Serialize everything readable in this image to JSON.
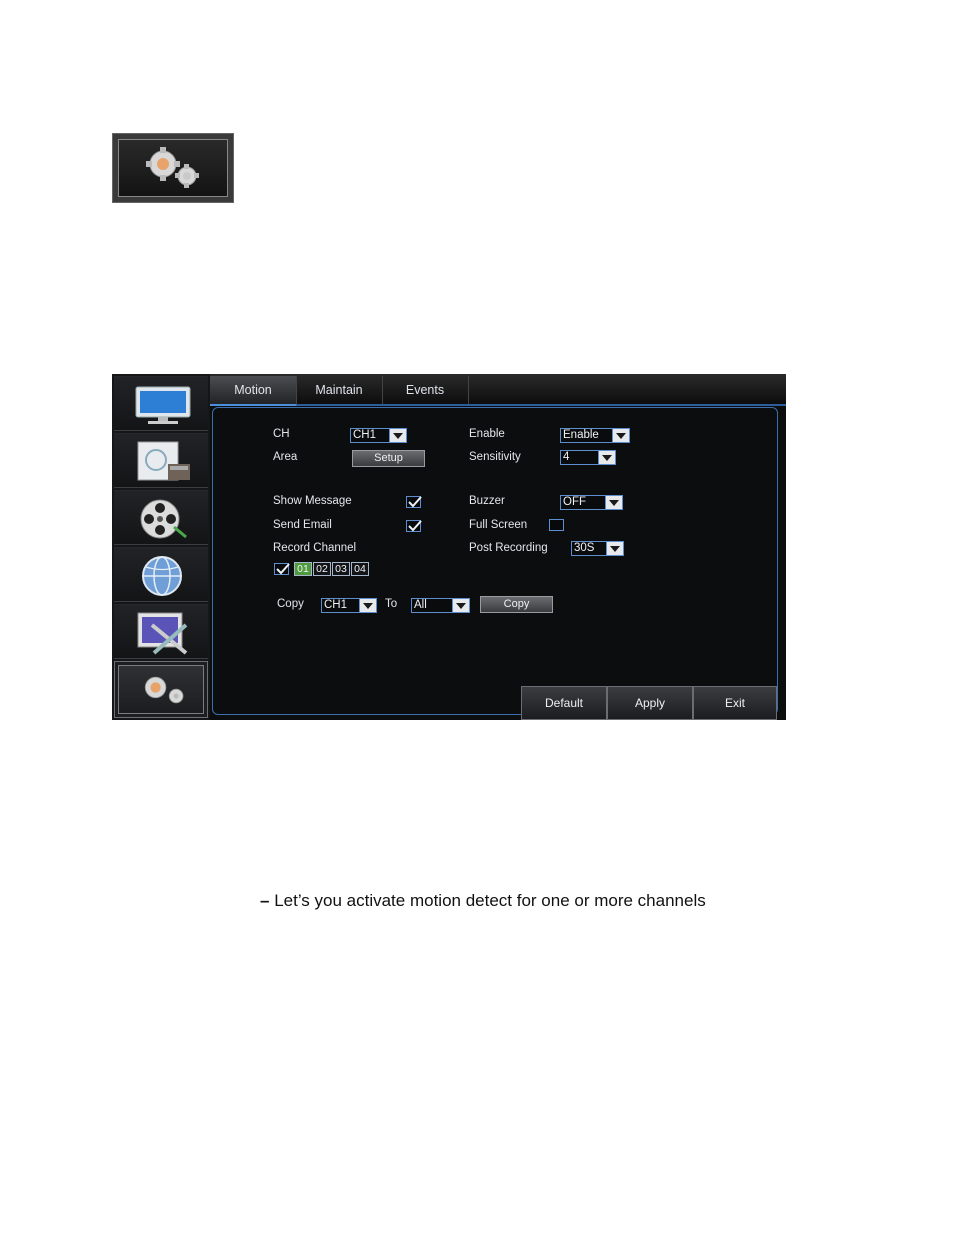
{
  "sidebar": {
    "items": [
      {
        "name": "display"
      },
      {
        "name": "record"
      },
      {
        "name": "search"
      },
      {
        "name": "network"
      },
      {
        "name": "system"
      },
      {
        "name": "advanced",
        "active": true
      }
    ]
  },
  "tabs": [
    {
      "label": "Motion",
      "active": true
    },
    {
      "label": "Maintain",
      "active": false
    },
    {
      "label": "Events",
      "active": false
    }
  ],
  "form": {
    "ch_label": "CH",
    "ch_value": "CH1",
    "enable_label": "Enable",
    "enable_value": "Enable",
    "area_label": "Area",
    "setup_button": "Setup",
    "sensitivity_label": "Sensitivity",
    "sensitivity_value": "4",
    "show_message_label": "Show Message",
    "show_message_checked": true,
    "buzzer_label": "Buzzer",
    "buzzer_value": "OFF",
    "send_email_label": "Send Email",
    "send_email_checked": true,
    "full_screen_label": "Full Screen",
    "full_screen_checked": false,
    "record_channel_label": "Record Channel",
    "record_all_checked": true,
    "post_recording_label": "Post Recording",
    "post_recording_value": "30S",
    "channels": [
      {
        "label": "01",
        "selected": true
      },
      {
        "label": "02",
        "selected": false
      },
      {
        "label": "03",
        "selected": false
      },
      {
        "label": "04",
        "selected": false
      }
    ],
    "copy_label": "Copy",
    "copy_from_value": "CH1",
    "to_label": "To",
    "copy_to_value": "All",
    "copy_button": "Copy"
  },
  "footer": {
    "default_button": "Default",
    "apply_button": "Apply",
    "exit_button": "Exit"
  },
  "caption": {
    "dash": "–",
    "text": " Let’s you activate motion detect for one or more channels"
  },
  "colors": {
    "accent_border": "#5d8fd0",
    "selected_channel": "#4e9a3c",
    "background": "#0c0d0f"
  }
}
